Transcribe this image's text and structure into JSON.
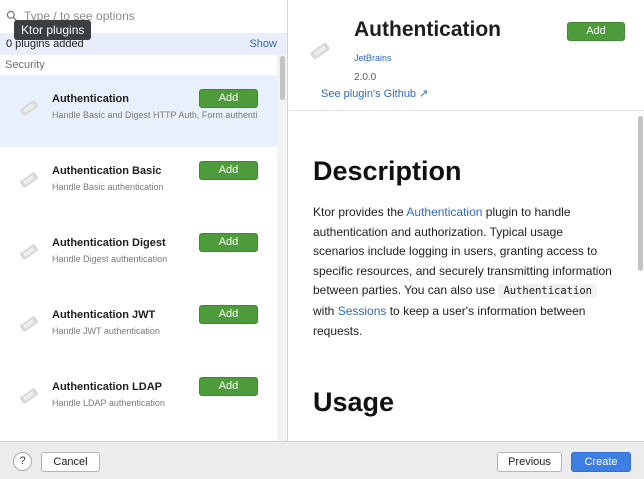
{
  "search": {
    "placeholder": "Type / to see options",
    "tooltip": "Ktor plugins"
  },
  "added_bar": {
    "text": "0 plugins added",
    "show_label": "Show"
  },
  "group_header": "Security",
  "plugins": [
    {
      "name": "Authentication",
      "description": "Handle Basic and Digest HTTP Auth, Form authenti",
      "add_label": "Add"
    },
    {
      "name": "Authentication Basic",
      "description": "Handle Basic authentication",
      "add_label": "Add"
    },
    {
      "name": "Authentication Digest",
      "description": "Handle Digest authentication",
      "add_label": "Add"
    },
    {
      "name": "Authentication JWT",
      "description": "Handle JWT authentication",
      "add_label": "Add"
    },
    {
      "name": "Authentication LDAP",
      "description": "Handle LDAP authentication",
      "add_label": "Add"
    }
  ],
  "detail": {
    "title": "Authentication",
    "vendor": "JetBrains",
    "version": "2.0.0",
    "github_link": "See plugin's Github ↗",
    "add_label": "Add",
    "description_heading": "Description",
    "desc_part1": "Ktor provides the ",
    "desc_link1": "Authentication",
    "desc_part2": " plugin to handle authentication and authorization. Typical usage scenarios include logging in users, granting access to specific resources, and securely transmitting information between parties. You can also use ",
    "desc_code": "Authentication",
    "desc_part3": " with ",
    "desc_link2": "Sessions",
    "desc_part4": " to keep a user's information between requests.",
    "usage_heading": "Usage"
  },
  "footer": {
    "help_label": "?",
    "cancel_label": "Cancel",
    "previous_label": "Previous",
    "create_label": "Create"
  },
  "colors": {
    "accent": "#3e7fe4",
    "add_green": "#4d9b3a",
    "link": "#2f6bbf",
    "selected_row": "#e8f1fb"
  }
}
